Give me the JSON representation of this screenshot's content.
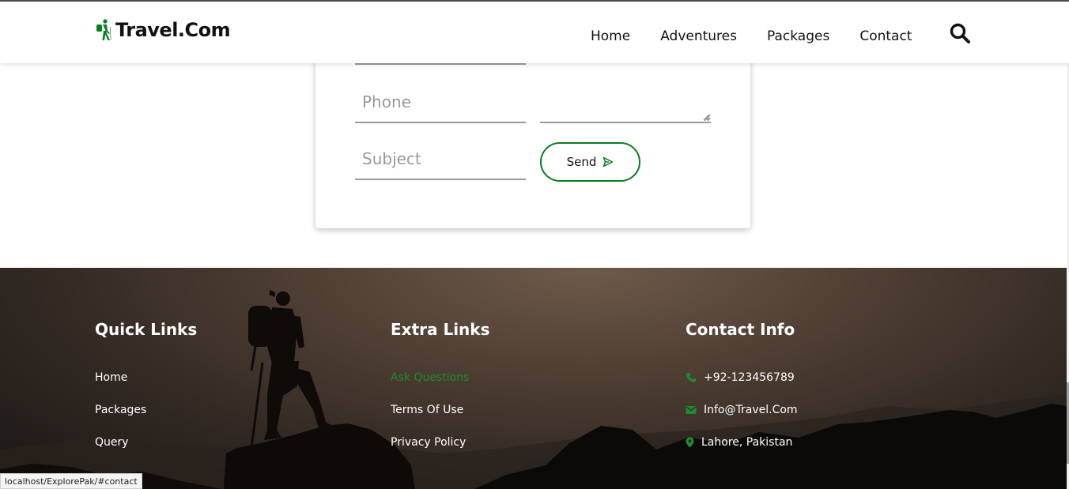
{
  "brand": {
    "name": "Travel.Com",
    "accent_color": "#0a7d1e",
    "logo_icon": "hiker-icon"
  },
  "nav": {
    "items": [
      {
        "label": "Home"
      },
      {
        "label": "Adventures"
      },
      {
        "label": "Packages"
      },
      {
        "label": "Contact"
      }
    ],
    "search_icon": "search-icon"
  },
  "contact_form": {
    "phone_placeholder": "Phone",
    "subject_placeholder": "Subject",
    "message_value": "",
    "send_label": "Send",
    "send_icon": "paper-plane-icon"
  },
  "footer": {
    "quick_links": {
      "title": "Quick Links",
      "items": [
        {
          "label": "Home"
        },
        {
          "label": "Packages"
        },
        {
          "label": "Query"
        }
      ]
    },
    "extra_links": {
      "title": "Extra Links",
      "items": [
        {
          "label": "Ask Questions",
          "active": true
        },
        {
          "label": "Terms Of Use"
        },
        {
          "label": "Privacy Policy"
        }
      ]
    },
    "contact_info": {
      "title": "Contact Info",
      "phone": "+92-123456789",
      "email": "Info@Travel.Com",
      "location": "Lahore, Pakistan",
      "icon_color": "#1f8c2e"
    }
  },
  "status_bar": {
    "url": "localhost/ExplorePak/#contact"
  }
}
